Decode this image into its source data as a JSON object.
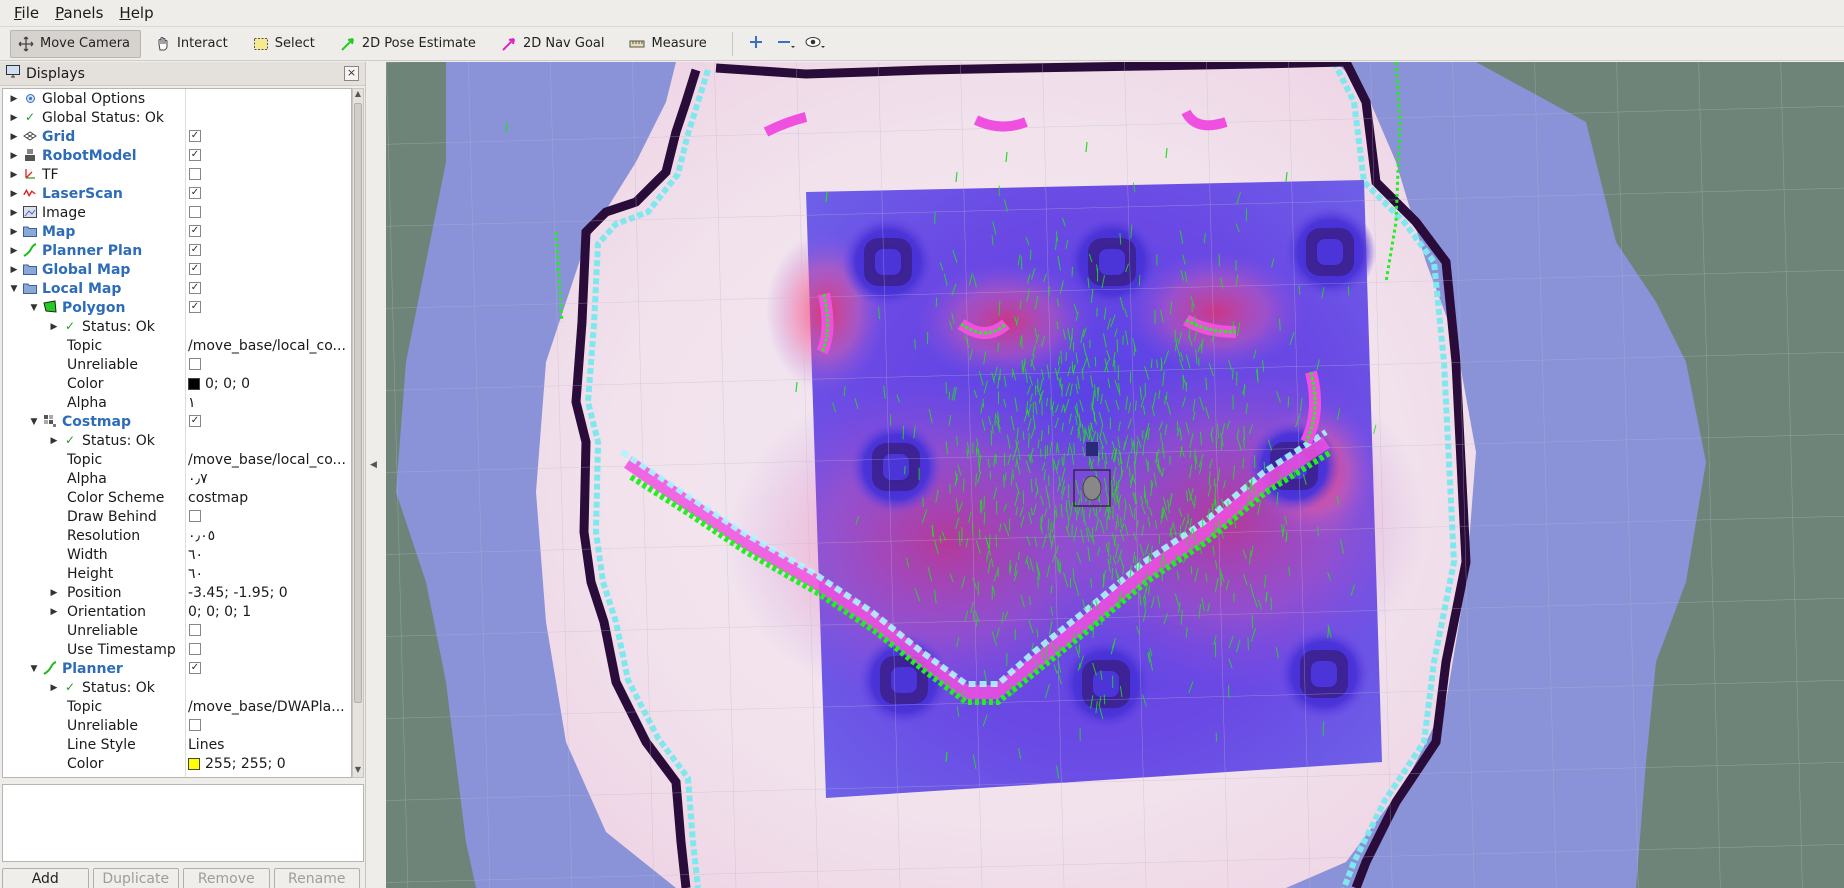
{
  "menu": {
    "file": {
      "underline": "F",
      "rest": "ile"
    },
    "panels": {
      "underline": "P",
      "rest": "anels"
    },
    "help": {
      "underline": "H",
      "rest": "elp"
    }
  },
  "toolbar": {
    "move_camera": "Move Camera",
    "interact": "Interact",
    "select": "Select",
    "pose_estimate": "2D Pose Estimate",
    "nav_goal": "2D Nav Goal",
    "measure": "Measure"
  },
  "panel": {
    "title": "Displays",
    "close": "×"
  },
  "tree": [
    {
      "depth": 0,
      "exp": "▶",
      "icon": "gear-icon",
      "label": "Global Options",
      "style": "plain"
    },
    {
      "depth": 0,
      "exp": "▶",
      "icon": "check-icon",
      "label": "Global Status: Ok",
      "style": "plain"
    },
    {
      "depth": 0,
      "exp": "▶",
      "icon": "grid-icon",
      "label": "Grid",
      "style": "display",
      "check": true
    },
    {
      "depth": 0,
      "exp": "▶",
      "icon": "robot-icon",
      "label": "RobotModel",
      "style": "display",
      "check": true
    },
    {
      "depth": 0,
      "exp": "▶",
      "icon": "tf-icon",
      "label": "TF",
      "style": "plain",
      "check": false
    },
    {
      "depth": 0,
      "exp": "▶",
      "icon": "laser-icon",
      "label": "LaserScan",
      "style": "display",
      "check": true
    },
    {
      "depth": 0,
      "exp": "▶",
      "icon": "image-icon",
      "label": "Image",
      "style": "plain",
      "check": false
    },
    {
      "depth": 0,
      "exp": "▶",
      "icon": "folder-icon",
      "label": "Map",
      "style": "display",
      "check": true
    },
    {
      "depth": 0,
      "exp": "▶",
      "icon": "path-icon",
      "label": "Planner Plan",
      "style": "display",
      "check": true
    },
    {
      "depth": 0,
      "exp": "▶",
      "icon": "folder-icon",
      "label": "Global Map",
      "style": "display",
      "check": true
    },
    {
      "depth": 0,
      "exp": "▼",
      "icon": "folder-icon",
      "label": "Local Map",
      "style": "display",
      "check": true
    },
    {
      "depth": 1,
      "exp": "▼",
      "icon": "polygon-icon",
      "label": "Polygon",
      "style": "display",
      "check": true
    },
    {
      "depth": 2,
      "exp": "▶",
      "icon": "check-icon",
      "label": "Status: Ok",
      "style": "plain"
    },
    {
      "depth": 2,
      "label": "Topic",
      "style": "plain",
      "value": "/move_base/local_co..."
    },
    {
      "depth": 2,
      "label": "Unreliable",
      "style": "plain",
      "check": false
    },
    {
      "depth": 2,
      "label": "Color",
      "style": "plain",
      "value": "0; 0; 0",
      "swatch": "#000000"
    },
    {
      "depth": 2,
      "label": "Alpha",
      "style": "plain",
      "value": "١"
    },
    {
      "depth": 1,
      "exp": "▼",
      "icon": "costmap-icon",
      "label": "Costmap",
      "style": "display",
      "check": true
    },
    {
      "depth": 2,
      "exp": "▶",
      "icon": "check-icon",
      "label": "Status: Ok",
      "style": "plain"
    },
    {
      "depth": 2,
      "label": "Topic",
      "style": "plain",
      "value": "/move_base/local_co..."
    },
    {
      "depth": 2,
      "label": "Alpha",
      "style": "plain",
      "value": "٠٫٧"
    },
    {
      "depth": 2,
      "label": "Color Scheme",
      "style": "plain",
      "value": "costmap"
    },
    {
      "depth": 2,
      "label": "Draw Behind",
      "style": "plain",
      "check": false
    },
    {
      "depth": 2,
      "label": "Resolution",
      "style": "plain",
      "value": "٠٫٠٥"
    },
    {
      "depth": 2,
      "label": "Width",
      "style": "plain",
      "value": "٦٠"
    },
    {
      "depth": 2,
      "label": "Height",
      "style": "plain",
      "value": "٦٠"
    },
    {
      "depth": 2,
      "exp": "▶",
      "label": "Position",
      "style": "plain",
      "value": "-3.45; -1.95; 0"
    },
    {
      "depth": 2,
      "exp": "▶",
      "label": "Orientation",
      "style": "plain",
      "value": "0; 0; 0; 1"
    },
    {
      "depth": 2,
      "label": "Unreliable",
      "style": "plain",
      "check": false
    },
    {
      "depth": 2,
      "label": "Use Timestamp",
      "style": "plain",
      "check": false
    },
    {
      "depth": 1,
      "exp": "▼",
      "icon": "path-icon",
      "label": "Planner",
      "style": "display",
      "check": true
    },
    {
      "depth": 2,
      "exp": "▶",
      "icon": "check-icon",
      "label": "Status: Ok",
      "style": "plain"
    },
    {
      "depth": 2,
      "label": "Topic",
      "style": "plain",
      "value": "/move_base/DWAPla..."
    },
    {
      "depth": 2,
      "label": "Unreliable",
      "style": "plain",
      "check": false
    },
    {
      "depth": 2,
      "label": "Line Style",
      "style": "plain",
      "value": "Lines"
    },
    {
      "depth": 2,
      "label": "Color",
      "style": "plain",
      "value": "255; 255; 0",
      "swatch": "#ffff00"
    }
  ],
  "buttons": {
    "add": "Add",
    "duplicate": "Duplicate",
    "remove": "Remove",
    "rename": "Rename"
  },
  "colors": {
    "accent_label": "#2e6cb8",
    "status_ok": "#2a9a2a",
    "path_green": "#22ee22",
    "costmap_blue": "#5a4ae0",
    "inflation_red": "#ff3b5c"
  }
}
